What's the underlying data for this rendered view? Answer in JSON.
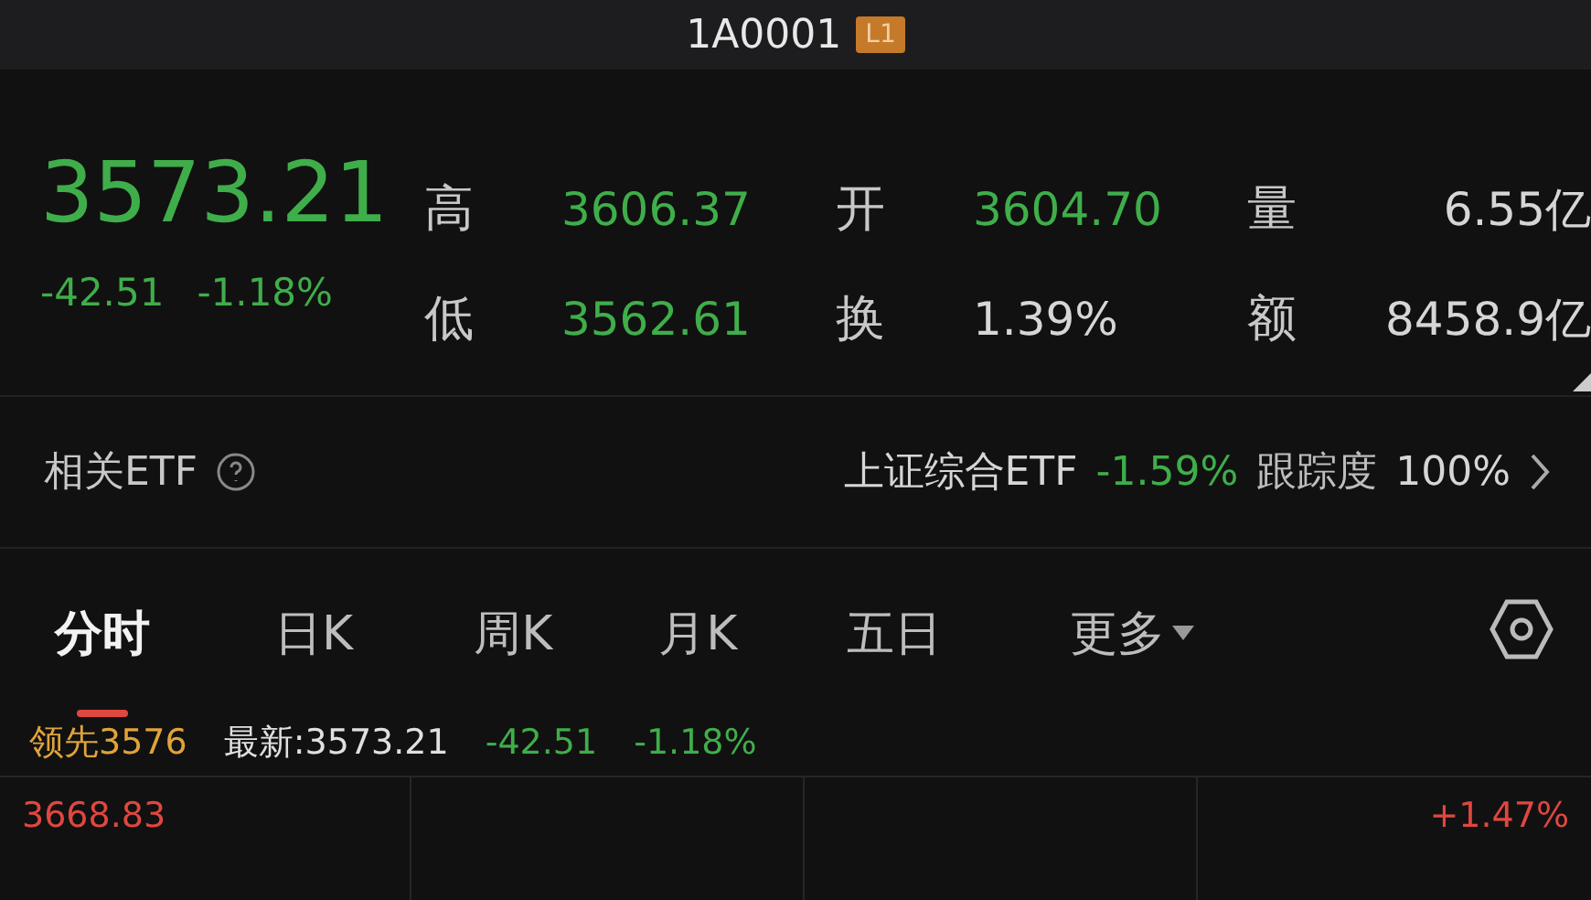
{
  "header": {
    "title": "1A0001",
    "badge": "L1"
  },
  "quote": {
    "price": "3573.21",
    "change": "-42.51",
    "change_pct": "-1.18%",
    "color": "#3fae4a",
    "stats": [
      {
        "label": "高",
        "value": "3606.37",
        "color": "#3fae4a"
      },
      {
        "label": "开",
        "value": "3604.70",
        "color": "#3fae4a"
      },
      {
        "label": "量",
        "value": "6.55亿",
        "color": "#d6d6d6"
      },
      {
        "label": "低",
        "value": "3562.61",
        "color": "#3fae4a"
      },
      {
        "label": "换",
        "value": "1.39%",
        "color": "#d6d6d6"
      },
      {
        "label": "额",
        "value": "8458.9亿",
        "color": "#d6d6d6"
      }
    ]
  },
  "etf": {
    "label": "相关ETF",
    "name": "上证综合ETF",
    "change": "-1.59%",
    "tracking_label": "跟踪度",
    "tracking_value": "100%"
  },
  "tabs": [
    {
      "label": "分时",
      "selected": true,
      "kind": "tab"
    },
    {
      "label": "日K",
      "selected": false,
      "kind": "tab"
    },
    {
      "label": "周K",
      "selected": false,
      "kind": "tab"
    },
    {
      "label": "月K",
      "selected": false,
      "kind": "tab"
    },
    {
      "label": "五日",
      "selected": false,
      "kind": "tab"
    },
    {
      "label": "更多",
      "selected": false,
      "kind": "menu"
    }
  ],
  "info": {
    "lead": "领先3576",
    "latest": "最新:3573.21",
    "change": "-42.51",
    "change_pct": "-1.18%"
  },
  "chart": {
    "top_price": "3668.83",
    "top_pct": "+1.47%"
  }
}
